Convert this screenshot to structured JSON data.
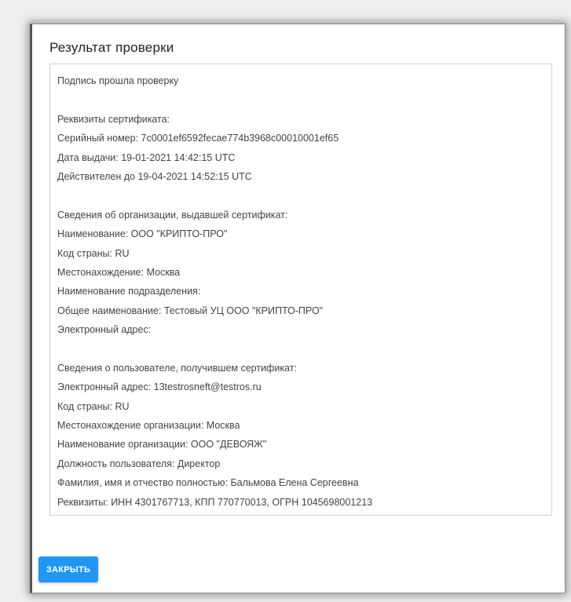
{
  "dialog": {
    "title": "Результат проверки",
    "close_label": "ЗАКРЫТЬ"
  },
  "result": {
    "lines": [
      "Подпись прошла проверку",
      "",
      "Реквизиты сертификата:",
      "Серийный номер: 7c0001ef6592fecae774b3968c00010001ef65",
      "Дата выдачи: 19-01-2021 14:42:15 UTC",
      "Действителен до 19-04-2021 14:52:15 UTC",
      "",
      "Сведения об организации, выдавшей сертификат:",
      "Наименование: ООО \"КРИПТО-ПРО\"",
      "Код страны: RU",
      "Местонахождение: Москва",
      "Наименование подразделения:",
      "Общее наименование: Тестовый УЦ ООО \"КРИПТО-ПРО\"",
      "Электронный адрес:",
      "",
      "Сведения о пользователе, получившем сертификат:",
      "Электронный адрес: 13testrosneft@testros.ru",
      "Код страны: RU",
      "Местонахождение организации: Москва",
      "Наименование организации: ООО \"ДЕВОЯЖ\"",
      "Должность пользователя: Директор",
      "Фамилия, имя и отчество полностью: Бальмова Елена Сергеевна",
      "Реквизиты: ИНН 4301767713, КПП 770770013, ОГРН 1045698001213"
    ]
  },
  "colors": {
    "accent": "#2196f3",
    "text": "#444444",
    "title": "#222222"
  }
}
